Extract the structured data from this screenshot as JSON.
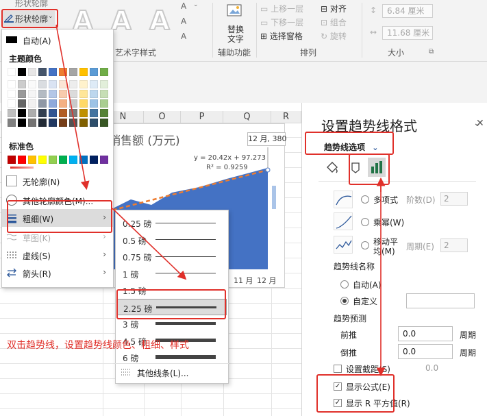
{
  "ribbon": {
    "shape_outline_top_partial": "形状轮廓",
    "shape_outline_button": "形状轮廓",
    "wordart_group_label": "艺术字样式",
    "accessibility_group_label": "辅助功能",
    "alt_text_button_line1": "替换",
    "alt_text_button_line2": "文字",
    "bring_forward": "上移一层",
    "send_backward": "下移一层",
    "selection_pane": "选择窗格",
    "align": "对齐",
    "group": "组合",
    "rotate": "旋转",
    "arrange_group_label": "排列",
    "height_value": "6.84 厘米",
    "width_value": "11.68 厘米",
    "size_group_label": "大小"
  },
  "outline_menu": {
    "auto": "自动(A)",
    "theme_colors_label": "主题颜色",
    "standard_colors_label": "标准色",
    "no_outline": "无轮廓(N)",
    "more_colors": "其他轮廓颜色(M)...",
    "weight": "粗细(W)",
    "sketch": "草图(K)",
    "dashes": "虚线(S)",
    "arrows": "箭头(R)",
    "theme_top_row": [
      "#ffffff",
      "#000000",
      "#e7e6e6",
      "#44546a",
      "#4472c4",
      "#ed7d31",
      "#a5a5a5",
      "#ffc000",
      "#5b9bd5",
      "#70ad47"
    ],
    "standard_row": [
      "#c00000",
      "#ff0000",
      "#ffc000",
      "#ffff00",
      "#92d050",
      "#00b050",
      "#00b0f0",
      "#0070c0",
      "#002060",
      "#7030a0"
    ]
  },
  "weight_menu": {
    "options": [
      "0.25 磅",
      "0.5 磅",
      "0.75 磅",
      "1 磅",
      "1.5 磅",
      "2.25 磅",
      "3 磅",
      "4.5 磅",
      "6 磅"
    ],
    "selected": "2.25 磅",
    "more_lines": "其他线条(L)..."
  },
  "sheet": {
    "columns": [
      "N",
      "O",
      "P",
      "Q",
      "R"
    ]
  },
  "chart": {
    "title": "销售额 (万元)",
    "equation": "y = 20.42x + 97.273",
    "r_squared": "R² = 0.9259",
    "data_label": "12 月, 380",
    "x_labels": [
      "11 月",
      "12 月"
    ],
    "area_color": "#4472c4",
    "trendline_color": "#ed7d31"
  },
  "format_pane": {
    "title": "设置趋势线格式",
    "options_tab": "趋势线选项",
    "polynomial": "多项式",
    "order_label": "阶数(D)",
    "order_value": "2",
    "power": "乘幂(W)",
    "moving_avg_line1": "移动平",
    "moving_avg_line2": "均(M)",
    "period_label": "周期(E)",
    "period_value": "2",
    "name_label": "趋势线名称",
    "auto": "自动(A)",
    "custom": "自定义",
    "forecast_label": "趋势预测",
    "forward": "前推",
    "backward": "倒推",
    "forward_value": "0.0",
    "backward_value": "0.0",
    "period_unit": "周期",
    "intercept": "设置截距(S)",
    "intercept_value": "0.0",
    "show_equation": "显示公式(E)",
    "show_r2": "显示 R 平方值(R)"
  },
  "annotation": "双击趋势线，设置趋势线颜色、粗细、样式",
  "colors": {
    "accent_red": "#e0302a",
    "excel_green": "#217346"
  }
}
